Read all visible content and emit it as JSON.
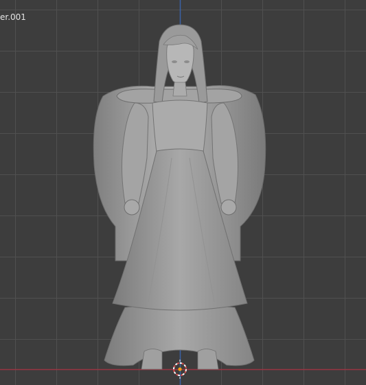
{
  "viewport": {
    "object_label": "er.001",
    "background": "#3d3d3d",
    "grid_color": "#505050",
    "x_axis_color": "#9b3443",
    "z_axis_color": "#3a62a6",
    "mesh_color": "#a9a9a9",
    "origin_color": "#f39c12",
    "cursor_color": "#ffffff",
    "cursor_ring_accent": "#d64a4a"
  }
}
